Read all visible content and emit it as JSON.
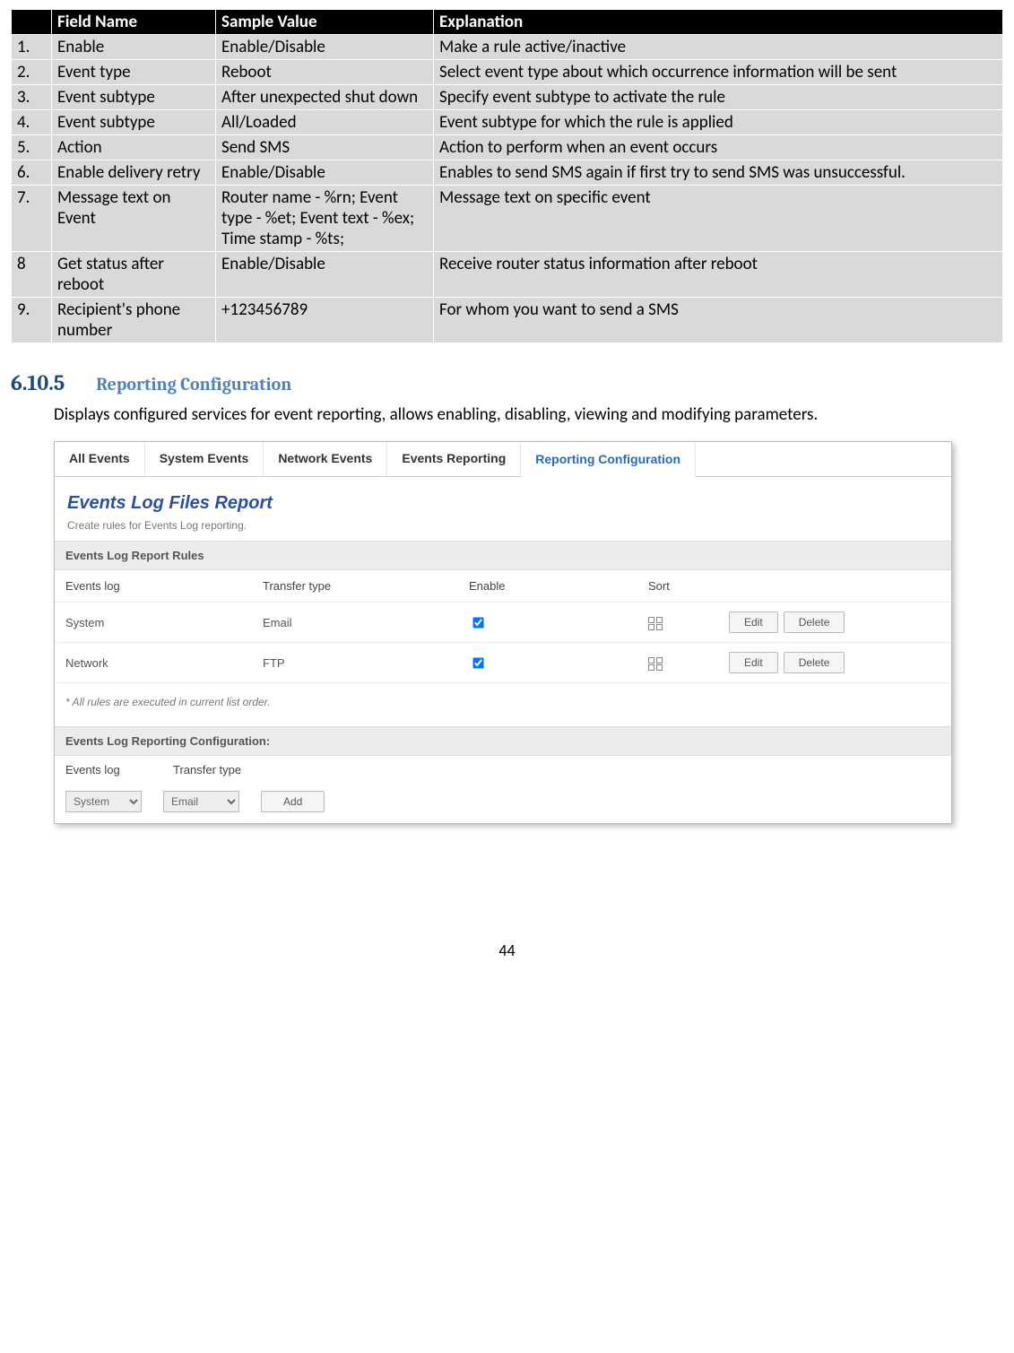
{
  "table": {
    "headers": [
      "",
      "Field Name",
      "Sample Value",
      "Explanation"
    ],
    "rows": [
      {
        "n": "1.",
        "field": "Enable",
        "sample": "Enable/Disable",
        "explain": "Make a rule active/inactive"
      },
      {
        "n": "2.",
        "field": "Event type",
        "sample": "Reboot",
        "explain": "Select event type about which occurrence information will be sent"
      },
      {
        "n": "3.",
        "field": "Event subtype",
        "sample": "After unexpected shut down",
        "explain": "Specify event subtype to activate the rule"
      },
      {
        "n": "4.",
        "field": "Event subtype",
        "sample": "All/Loaded",
        "explain": "Event subtype for which the rule is applied"
      },
      {
        "n": "5.",
        "field": "Action",
        "sample": "Send SMS",
        "explain": "Action to perform when an event occurs"
      },
      {
        "n": "6.",
        "field": "Enable delivery retry",
        "sample": "Enable/Disable",
        "explain": "Enables to send SMS again if first try to send SMS was unsuccessful."
      },
      {
        "n": "7.",
        "field": "Message text  on Event",
        "sample": "Router name - %rn; Event type - %et; Event text - %ex; Time stamp - %ts;",
        "explain": "Message text on specific event"
      },
      {
        "n": "8",
        "field": "Get status after reboot",
        "sample": "Enable/Disable",
        "explain": "Receive router status information after reboot"
      },
      {
        "n": "9.",
        "field": "Recipient's phone number",
        "sample": "+123456789",
        "explain": "For whom you want to send a SMS"
      }
    ]
  },
  "section": {
    "number": "6.10.5",
    "title": "Reporting Configuration",
    "description": "Displays configured services for event reporting, allows enabling, disabling, viewing and modifying parameters."
  },
  "screenshot": {
    "tabs": [
      "All Events",
      "System Events",
      "Network Events",
      "Events Reporting",
      "Reporting Configuration"
    ],
    "activeTab": "Reporting Configuration",
    "panelTitle": "Events Log Files Report",
    "panelSub": "Create rules for Events Log reporting.",
    "band1": "Events Log Report Rules",
    "rulesHeader": {
      "log": "Events log",
      "transfer": "Transfer type",
      "enable": "Enable",
      "sort": "Sort"
    },
    "rules": [
      {
        "log": "System",
        "transfer": "Email",
        "enabled": true
      },
      {
        "log": "Network",
        "transfer": "FTP",
        "enabled": true
      }
    ],
    "editLabel": "Edit",
    "deleteLabel": "Delete",
    "note": "* All rules are executed in current list order.",
    "band2": "Events Log Reporting Configuration:",
    "configHead": {
      "log": "Events log",
      "transfer": "Transfer type"
    },
    "selectLog": "System",
    "selectTransfer": "Email",
    "addLabel": "Add"
  },
  "pageNumber": "44"
}
